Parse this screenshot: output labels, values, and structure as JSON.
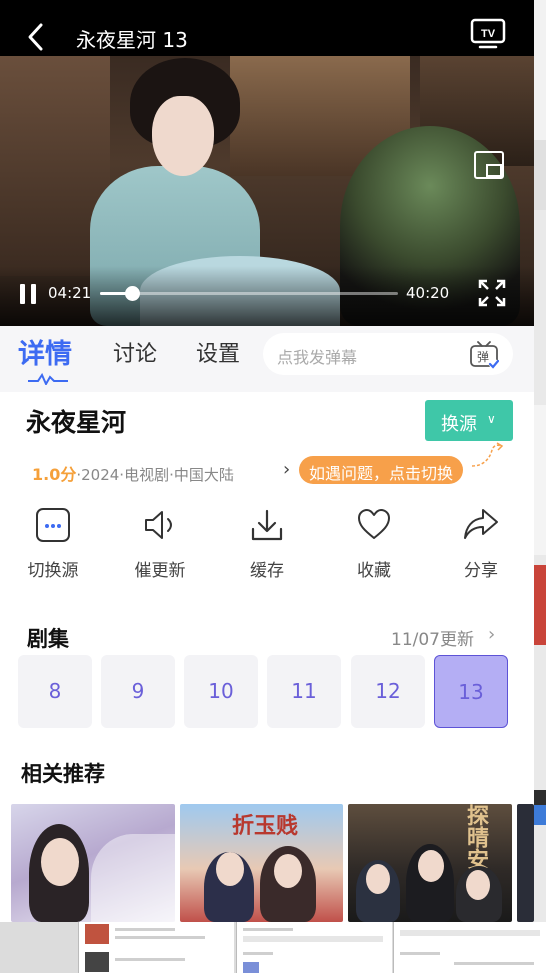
{
  "header": {
    "title": "永夜星河 13"
  },
  "player": {
    "current_time": "04:21",
    "total_time": "40:20",
    "progress_fraction": 0.108
  },
  "tabs": [
    {
      "label": "详情",
      "active": true
    },
    {
      "label": "讨论",
      "active": false
    },
    {
      "label": "设置",
      "active": false
    }
  ],
  "danmu": {
    "placeholder": "点我发弹幕",
    "icon_label": "弹"
  },
  "detail": {
    "title": "永夜星河",
    "switch_source_label": "换源",
    "score": "1.0分",
    "meta": "·2024·电视剧·中国大陆",
    "tip": "如遇问题，点击切换"
  },
  "actions": [
    {
      "label": "切换源",
      "icon": "more-dots-icon"
    },
    {
      "label": "催更新",
      "icon": "speaker-icon"
    },
    {
      "label": "缓存",
      "icon": "download-icon"
    },
    {
      "label": "收藏",
      "icon": "heart-icon"
    },
    {
      "label": "分享",
      "icon": "share-icon"
    }
  ],
  "episodes": {
    "title": "剧集",
    "update_text": "11/07更新",
    "items": [
      "8",
      "9",
      "10",
      "11",
      "12",
      "13"
    ],
    "active_index": 5
  },
  "recommend": {
    "title": "相关推荐",
    "poster3_text": "探晴安",
    "poster2_text": "折玉贱"
  },
  "colors": {
    "accent_blue": "#3d6bf2",
    "switch_green": "#3fc7a8",
    "tip_orange": "#f7a04a",
    "episode_purple": "#6a5fd9",
    "episode_active_bg": "#b4aef4"
  }
}
